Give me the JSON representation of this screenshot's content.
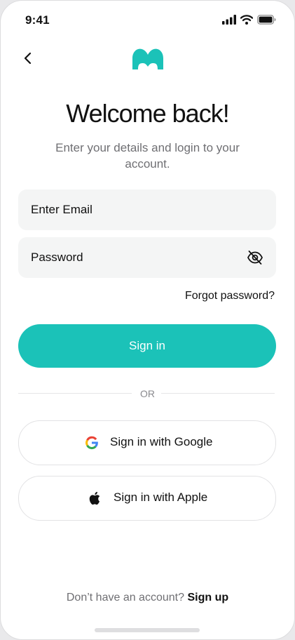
{
  "status_bar": {
    "time": "9:41",
    "icons": [
      "signal-icon",
      "wifi-icon",
      "battery-icon"
    ]
  },
  "header": {
    "back_icon": "chevron-left-icon",
    "logo_icon": "brand-logo"
  },
  "title": "Welcome back!",
  "subtitle": "Enter your details and login to your account.",
  "form": {
    "email_placeholder": "Enter Email",
    "password_placeholder": "Password",
    "password_toggle_icon": "eye-off-icon",
    "forgot_label": "Forgot password?",
    "submit_label": "Sign in"
  },
  "divider_label": "OR",
  "social": {
    "google_label": "Sign in with Google",
    "google_icon": "google-icon",
    "apple_label": "Sign in with Apple",
    "apple_icon": "apple-icon"
  },
  "footer": {
    "prompt": "Don’t have an account?",
    "link": "Sign up"
  },
  "colors": {
    "accent": "#1bc2b8",
    "field_bg": "#f4f5f5",
    "text": "#111111",
    "muted": "#6f6f73"
  }
}
